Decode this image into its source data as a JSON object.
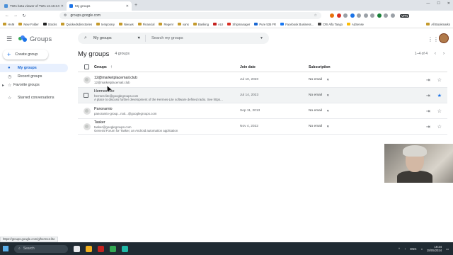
{
  "browser": {
    "tabs": [
      {
        "title": "TWA beta viewer of TWA v2.10.3.5",
        "active": false
      },
      {
        "title": "My groups",
        "active": true
      }
    ],
    "url": "groups.google.com",
    "vpn_label": "VPN",
    "bookmarks": [
      "HAM",
      "New Folder",
      "Stocks",
      "Quickedsdirectories",
      "temporary",
      "Nieuws",
      "Financial",
      "Regen!",
      "vans",
      "Banking",
      "ALII",
      "Shipmanager",
      "Pure 535 FR",
      "Facebook Business...",
      "CRI Alfa Tango",
      "AdSense"
    ],
    "all_bookmarks": "All Bookmarks"
  },
  "app": {
    "name": "Groups",
    "search_scope": "My groups",
    "search_placeholder": "Search my groups"
  },
  "sidebar": {
    "create_label": "Create group",
    "items": [
      {
        "label": "My groups",
        "active": true
      },
      {
        "label": "Recent groups",
        "active": false
      },
      {
        "label": "Favorite groups",
        "active": false
      },
      {
        "label": "Starred conversations",
        "active": false
      }
    ]
  },
  "main": {
    "title": "My groups",
    "count": "4 groups",
    "pager": "1–4 of 4",
    "columns": {
      "groups": "Groups",
      "join_date": "Join date",
      "subscription": "Subscription"
    },
    "rows": [
      {
        "name": "12@marketplacemail.club",
        "email": "12@marketplacemail.club",
        "desc": "",
        "join": "Jul 10, 2020",
        "sub": "No email",
        "starred": false
      },
      {
        "name": "Hermes Lite",
        "email": "hermes-lite@googlegroups.com",
        "desc": "A place to discuss further development of the Hermes-Lite software defined radio. See https...",
        "join": "Jul 14, 2023",
        "sub": "No email",
        "starred": true
      },
      {
        "name": "Panoramio",
        "email": "panoramio-group...noti...@googlegroups.com",
        "desc": "",
        "join": "Sep 11, 2013",
        "sub": "No email",
        "starred": false
      },
      {
        "name": "Tasker",
        "email": "tasker@googlegroups.com",
        "desc": "General Forum for Tasker, an Android automation application",
        "join": "Nov 4, 2022",
        "sub": "No email",
        "starred": false
      }
    ]
  },
  "status_url": "https://groups.google.com/g/hermes-lite",
  "taskbar": {
    "search_label": "Search",
    "lang": "ENG",
    "time": "19:34",
    "date": "28/05/2024"
  }
}
